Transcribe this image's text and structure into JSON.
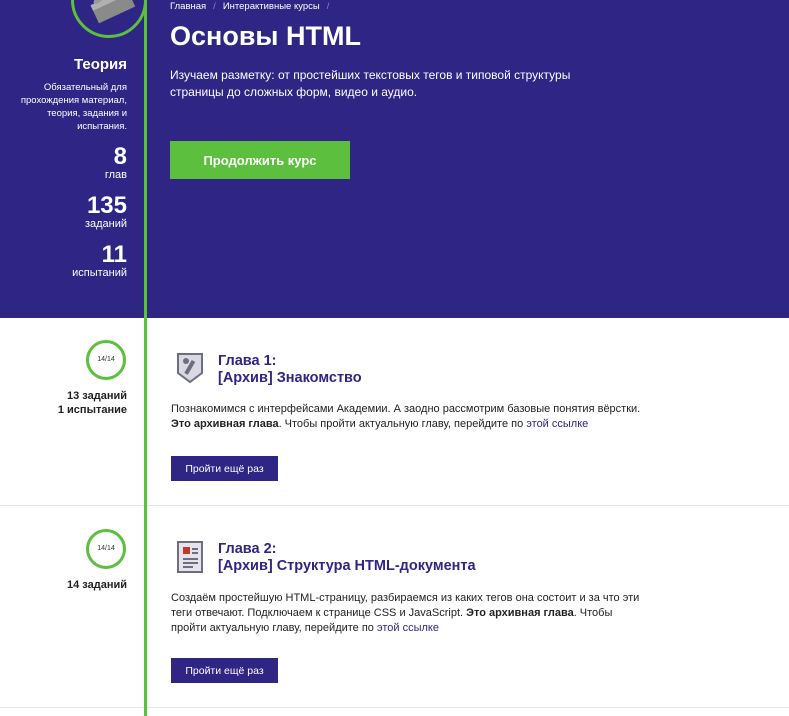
{
  "breadcrumb": [
    {
      "label": "Главная"
    },
    {
      "label": "Интерактивные курсы"
    }
  ],
  "breadcrumb_separator": "/",
  "course": {
    "title": "Основы HTML",
    "description": "Изучаем разметку: от простейших текстовых тегов и типовой структуры страницы до сложных форм, видео и аудио.",
    "continue_label": "Продолжить курс"
  },
  "sidebar": {
    "title": "Теория",
    "description": "Обязательный для прохождения материал, теория, задания и испытания.",
    "stats": [
      {
        "value": "8",
        "label": "глав"
      },
      {
        "value": "135",
        "label": "заданий"
      },
      {
        "value": "11",
        "label": "испытаний"
      }
    ]
  },
  "chapters": [
    {
      "progress": "14/14",
      "stats_line1": "13 заданий",
      "stats_line2": "1 испытание",
      "heading_line1": "Глава 1:",
      "heading_line2": "[Архив] Знакомство",
      "text_main": "Познакомимся с интерфейсами Академии. А заодно рассмотрим базовые понятия вёрстки.",
      "archive_bold": "Это архивная глава",
      "text_after": ". Чтобы пройти актуальную главу, перейдите по ",
      "link": "этой ссылке",
      "button": "Пройти ещё раз"
    },
    {
      "progress": "14/14",
      "stats_line1": "14 заданий",
      "heading_line1": "Глава 2:",
      "heading_line2": "[Архив] Структура HTML-документа",
      "text_main": "Создаём простейшую HTML-страницу, разбираемся из каких тегов она состоит и за что эти теги отвечают. Подключаем к странице CSS и JavaScript. ",
      "archive_bold": "Это архивная глава",
      "text_after": ". Чтобы пройти актуальную главу, перейдите по ",
      "link": "этой ссылке",
      "button": "Пройти ещё раз"
    }
  ],
  "colors": {
    "hero_bg": "#2e2585",
    "accent_green": "#5cbf3e",
    "button_dark": "#2e2585"
  },
  "icons": [
    "lego-brick-icon",
    "chapter-tool-icon",
    "chapter-document-icon"
  ]
}
